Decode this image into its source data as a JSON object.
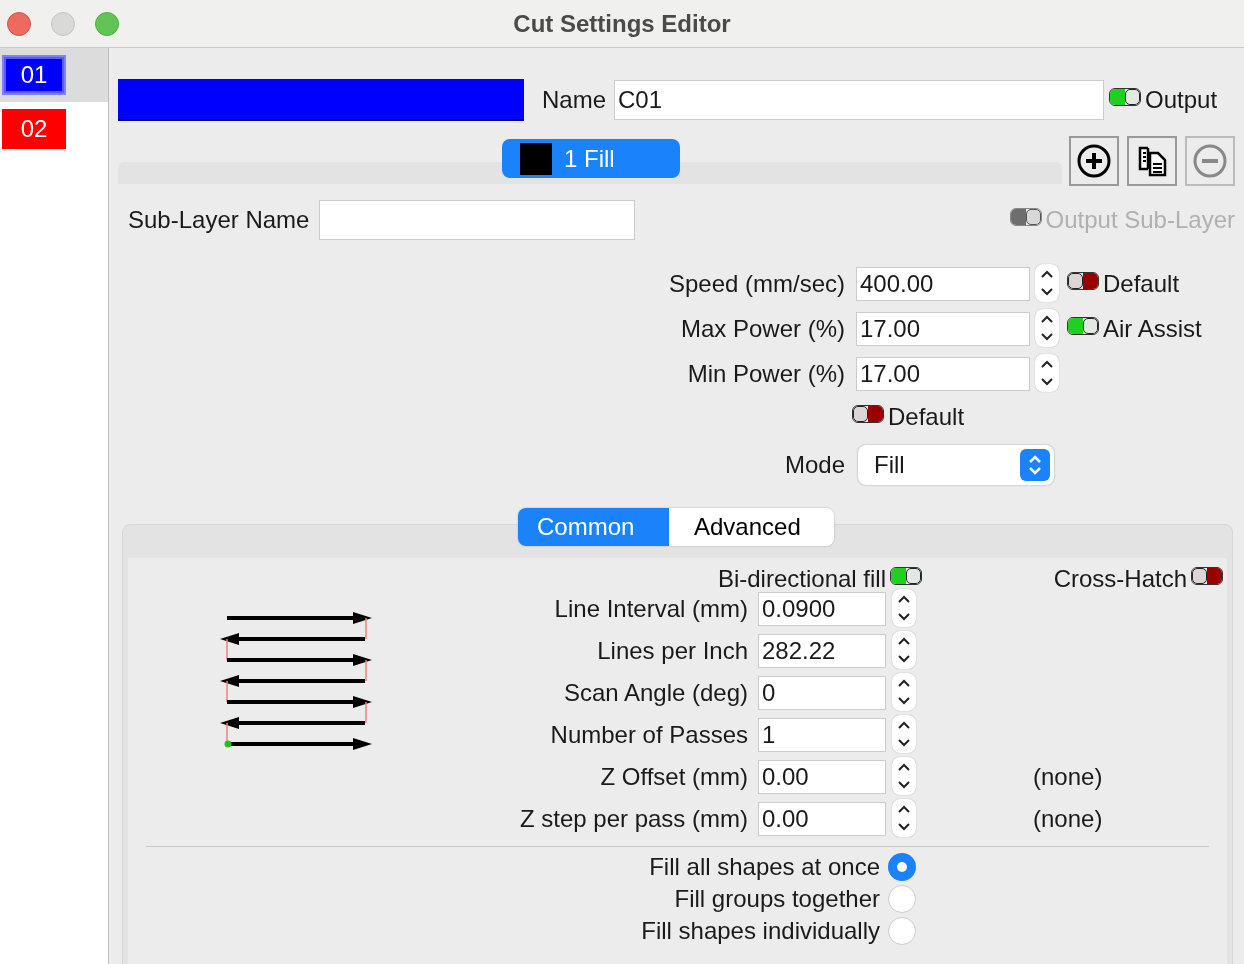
{
  "window": {
    "title": "Cut Settings Editor"
  },
  "layers": [
    {
      "label": "01",
      "color": "#0000ff",
      "selected": true
    },
    {
      "label": "02",
      "color": "#ff0000",
      "selected": false
    }
  ],
  "layer": {
    "color": "#0000ff",
    "name_label": "Name",
    "name": "C01",
    "output": {
      "label": "Output",
      "on": true
    }
  },
  "sub_layers": [
    {
      "label": "1 Fill",
      "color": "#000000",
      "selected": true
    }
  ],
  "sub_layer": {
    "name_label": "Sub-Layer Name",
    "output": {
      "label": "Output Sub-Layer",
      "on": true,
      "disabled": true
    }
  },
  "params": [
    {
      "label": "Speed (mm/sec)",
      "value": "400.00",
      "toggle": {
        "label": "Default",
        "on": false
      }
    },
    {
      "label": "Max Power (%)",
      "value": "17.00",
      "toggle": {
        "label": "Air Assist",
        "on": true
      }
    },
    {
      "label": "Min Power (%)",
      "value": "17.00"
    }
  ],
  "power_default": {
    "label": "Default",
    "on": false
  },
  "mode": {
    "label": "Mode",
    "value": "Fill"
  },
  "tabs": [
    {
      "label": "Common",
      "selected": true
    },
    {
      "label": "Advanced",
      "selected": false
    }
  ],
  "fill": {
    "bidirectional": {
      "label": "Bi-directional fill",
      "on": true
    },
    "cross_hatch": {
      "label": "Cross-Hatch",
      "on": false
    },
    "rows": [
      {
        "label": "Line Interval (mm)",
        "value": "0.0900"
      },
      {
        "label": "Lines per Inch",
        "value": "282.22"
      },
      {
        "label": "Scan Angle (deg)",
        "value": "0"
      },
      {
        "label": "Number of Passes",
        "value": "1"
      },
      {
        "label": "Z Offset (mm)",
        "value": "0.00",
        "note": "(none)"
      },
      {
        "label": "Z step per pass (mm)",
        "value": "0.00",
        "note": "(none)"
      }
    ],
    "order": [
      {
        "label": "Fill all shapes at once",
        "selected": true
      },
      {
        "label": "Fill groups together",
        "selected": false
      },
      {
        "label": "Fill shapes individually",
        "selected": false
      }
    ]
  }
}
